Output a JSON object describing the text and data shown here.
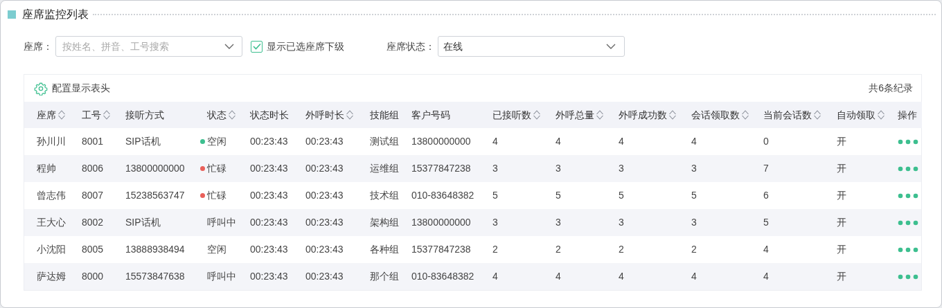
{
  "section_title": "座席监控列表",
  "filters": {
    "agent_label": "座席：",
    "agent_placeholder": "按姓名、拼音、工号搜索",
    "show_sub_checkbox": {
      "label": "显示已选座席下级",
      "checked": true
    },
    "status_label": "座席状态：",
    "status_value": "在线"
  },
  "table": {
    "config_button": "配置显示表头",
    "total": "共6条纪录",
    "columns": [
      {
        "label": "座席",
        "sortable": true
      },
      {
        "label": "工号",
        "sortable": true
      },
      {
        "label": "接听方式",
        "sortable": false
      },
      {
        "label": "状态",
        "sortable": true
      },
      {
        "label": "状态时长",
        "sortable": false
      },
      {
        "label": "外呼时长",
        "sortable": true
      },
      {
        "label": "技能组",
        "sortable": false
      },
      {
        "label": "客户号码",
        "sortable": false
      },
      {
        "label": "已接听数",
        "sortable": true
      },
      {
        "label": "外呼总量",
        "sortable": true
      },
      {
        "label": "外呼成功数",
        "sortable": true
      },
      {
        "label": "会话领取数",
        "sortable": true
      },
      {
        "label": "当前会话数",
        "sortable": true
      },
      {
        "label": "自动领取",
        "sortable": true
      },
      {
        "label": "操作",
        "sortable": false
      }
    ],
    "rows": [
      {
        "agent": "孙川川",
        "id": "8001",
        "answer_mode": "SIP话机",
        "status": {
          "text": "空闲",
          "color": "#3dbf8f"
        },
        "status_duration": "00:23:43",
        "outbound_duration": "00:23:43",
        "skill_group": "测试组",
        "customer_number": "13800000000",
        "answered": "4",
        "outbound_total": "4",
        "outbound_success": "4",
        "sessions_claimed": "4",
        "current_sessions": "0",
        "auto_claim": "开"
      },
      {
        "agent": "程帅",
        "id": "8006",
        "answer_mode": "13800000000",
        "status": {
          "text": "忙碌",
          "color": "#e9605a"
        },
        "status_duration": "00:23:43",
        "outbound_duration": "00:23:43",
        "skill_group": "运维组",
        "customer_number": "15377847238",
        "answered": "3",
        "outbound_total": "3",
        "outbound_success": "3",
        "sessions_claimed": "3",
        "current_sessions": "7",
        "auto_claim": "开"
      },
      {
        "agent": "曾志伟",
        "id": "8007",
        "answer_mode": "15238563747",
        "status": {
          "text": "忙碌",
          "color": "#e9605a"
        },
        "status_duration": "00:23:43",
        "outbound_duration": "00:23:43",
        "skill_group": "技术组",
        "customer_number": "010-83648382",
        "answered": "5",
        "outbound_total": "5",
        "outbound_success": "5",
        "sessions_claimed": "5",
        "current_sessions": "6",
        "auto_claim": "开"
      },
      {
        "agent": "王大心",
        "id": "8002",
        "answer_mode": "SIP话机",
        "status": {
          "text": "呼叫中"
        },
        "status_duration": "00:23:43",
        "outbound_duration": "00:23:43",
        "skill_group": "架构组",
        "customer_number": "13800000000",
        "answered": "3",
        "outbound_total": "3",
        "outbound_success": "3",
        "sessions_claimed": "3",
        "current_sessions": "5",
        "auto_claim": "开"
      },
      {
        "agent": "小沈阳",
        "id": "8005",
        "answer_mode": "13888938494",
        "status": {
          "text": "空闲"
        },
        "status_duration": "00:23:43",
        "outbound_duration": "00:23:43",
        "skill_group": "各种组",
        "customer_number": "15377847238",
        "answered": "2",
        "outbound_total": "2",
        "outbound_success": "2",
        "sessions_claimed": "2",
        "current_sessions": "4",
        "auto_claim": "开"
      },
      {
        "agent": "萨达姆",
        "id": "8000",
        "answer_mode": "15573847638",
        "status": {
          "text": "呼叫中"
        },
        "status_duration": "00:23:43",
        "outbound_duration": "00:23:43",
        "skill_group": "那个组",
        "customer_number": "010-83648382",
        "answered": "4",
        "outbound_total": "4",
        "outbound_success": "4",
        "sessions_claimed": "4",
        "current_sessions": "4",
        "auto_claim": "开"
      }
    ]
  }
}
